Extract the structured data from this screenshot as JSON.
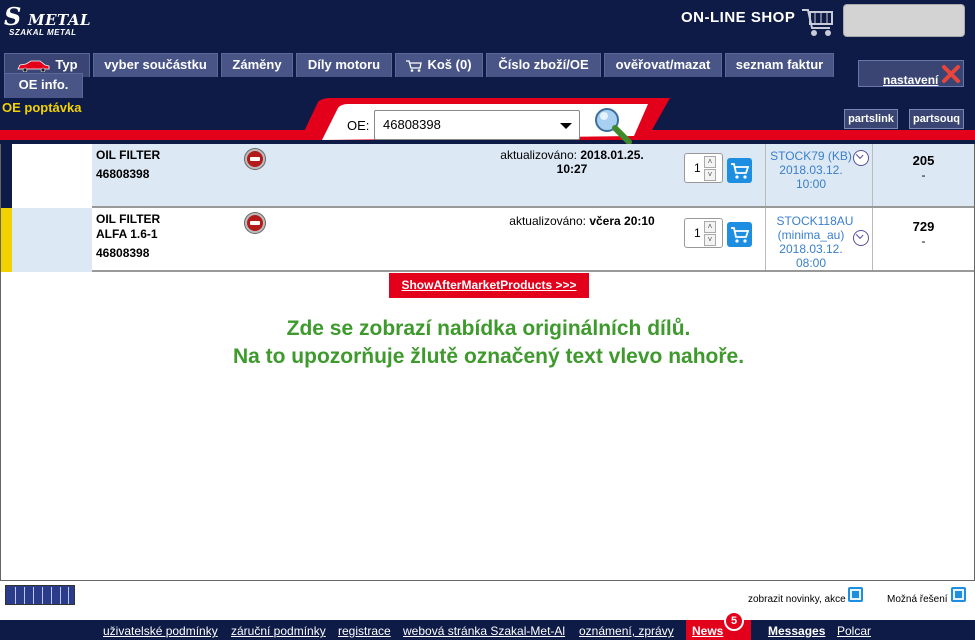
{
  "logo": {
    "mark": "S",
    "name_top": "METAL",
    "name_bottom": "SZAKAL METAL"
  },
  "shop_title": "ON-LINE SHOP",
  "nav": {
    "typ": "Typ",
    "vyber": "vyber součástku",
    "zameny": "Záměny",
    "dily_motoru": "Díly motoru",
    "kos": "Koš (0)",
    "cislo_zbozi": "Číslo zboží/OE",
    "overovat": "ověřovat/mazat",
    "seznam_faktur": "seznam faktur",
    "oe_info": "OE info."
  },
  "oe_poptavka": "OE poptávka",
  "nastaveni": "nastavení",
  "search": {
    "label": "OE:",
    "value": "46808398"
  },
  "side_buttons": {
    "partslink": "partslink",
    "partsouq": "partsouq"
  },
  "marker_colors": {
    "row1": "#0f1b47",
    "row2": "#f2d200"
  },
  "rows": [
    {
      "name": "OIL FILTER",
      "name2": "",
      "code": "46808398",
      "updated_label": "aktualizováno:",
      "updated_value": "2018.01.25. 10:27",
      "qty": "1",
      "stock_line1": "STOCK79 (KB)",
      "stock_line2": "2018.03.12.",
      "stock_line3": "10:00",
      "price": "205",
      "price2": "-"
    },
    {
      "name": "OIL FILTER",
      "name2": "ALFA 1.6-1",
      "code": "46808398",
      "updated_label": "aktualizováno:",
      "updated_value": "včera 20:10",
      "qty": "1",
      "stock_line1": "STOCK118AU",
      "stock_line2": "(minima_au)",
      "stock_line3": "2018.03.12.",
      "stock_line4": "08:00",
      "price": "729",
      "price2": "-"
    }
  ],
  "aftermarket_link": "ShowAfterMarketProducts >>>",
  "info": {
    "line1": "Zde se zobrazí nabídka originálních dílů.",
    "line2": "Na to upozorňuje  žlutě označený text vlevo nahoře."
  },
  "options": {
    "novinky": "zobrazit novinky, akce",
    "reseni": "Možná řešení"
  },
  "footer": {
    "uzivatelske": "uživatelské podmínky",
    "zarucni": "záruční podmínky",
    "registrace": "registrace",
    "webova": "webová stránka Szakal-Met-Al",
    "oznameni": "oznámení, zprávy",
    "news": "News",
    "news_count": "5",
    "messages": "Messages",
    "polcar": "Polcar"
  }
}
